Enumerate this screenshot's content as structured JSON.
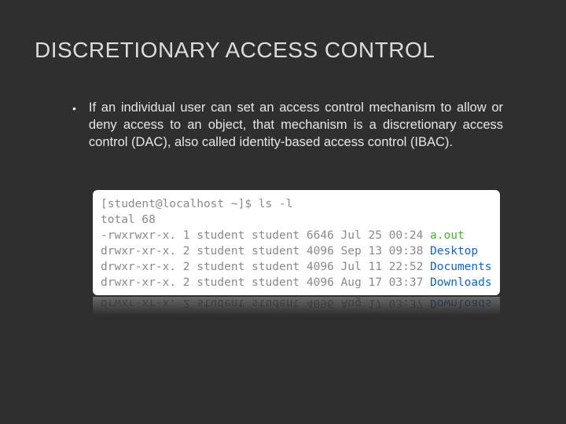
{
  "title": "DISCRETIONARY ACCESS CONTROL",
  "bullet": "If an individual user can set an access control mechanism to allow or deny access to an object, that mechanism is a discretionary access control (DAC), also called identity-based access control (IBAC).",
  "terminal": {
    "prompt": "[student@localhost ~]$ ",
    "cmd": "ls -l",
    "total": "total 68",
    "rows": [
      {
        "perm": "-rwxrwxr-x.",
        "links": "1",
        "user": "student",
        "group": "student",
        "size": "6646",
        "date": "Jul 25 00:24",
        "name": "a.out",
        "cls": "t-green"
      },
      {
        "perm": "drwxr-xr-x.",
        "links": "2",
        "user": "student",
        "group": "student",
        "size": "4096",
        "date": "Sep 13 09:38",
        "name": "Desktop",
        "cls": "t-blue"
      },
      {
        "perm": "drwxr-xr-x.",
        "links": "2",
        "user": "student",
        "group": "student",
        "size": "4096",
        "date": "Jul 11 22:52",
        "name": "Documents",
        "cls": "t-blue"
      },
      {
        "perm": "drwxr-xr-x.",
        "links": "2",
        "user": "student",
        "group": "student",
        "size": "4096",
        "date": "Aug 17 03:37",
        "name": "Downloads",
        "cls": "t-blue"
      }
    ]
  }
}
